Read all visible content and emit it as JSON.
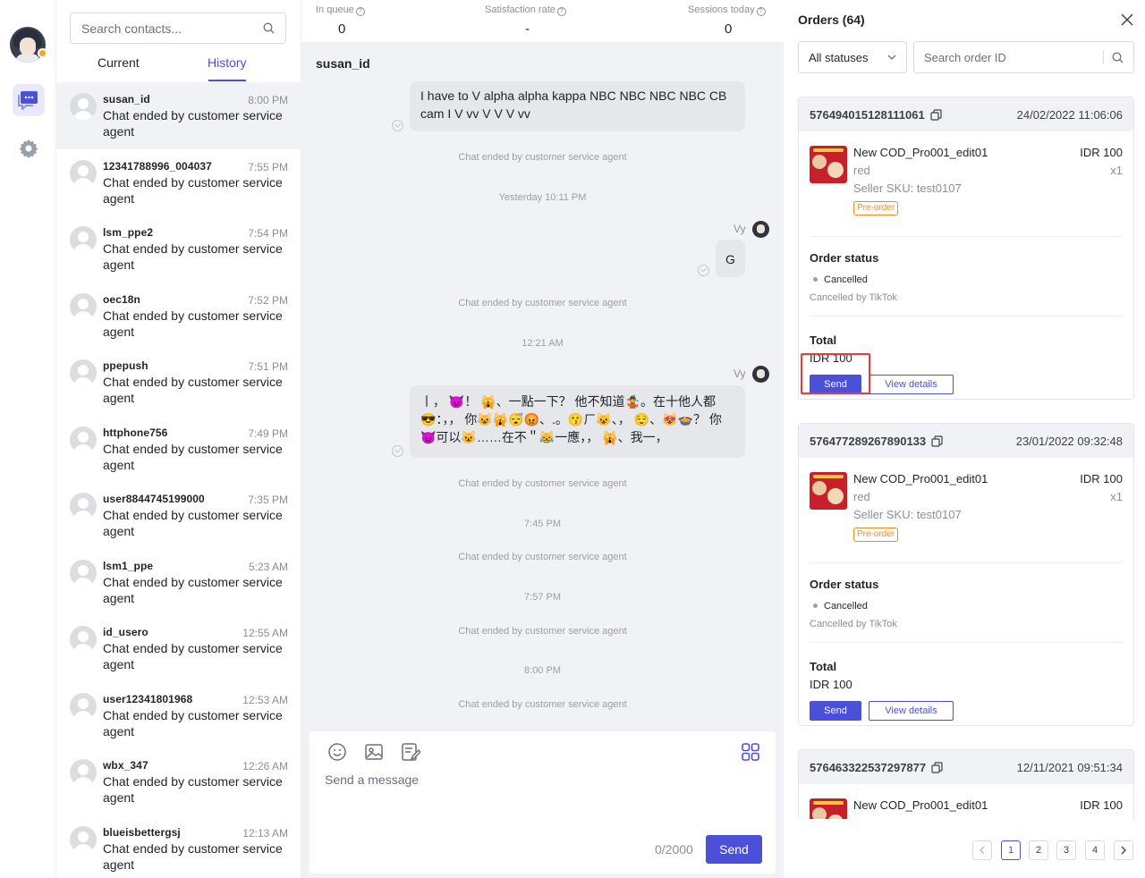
{
  "rail": {
    "items": [
      {
        "name": "chat-icon",
        "active": true
      },
      {
        "name": "gear-icon",
        "active": false
      }
    ]
  },
  "contacts": {
    "search_placeholder": "Search contacts...",
    "tabs": {
      "current": "Current",
      "history": "History"
    },
    "list": [
      {
        "name": "susan_id",
        "time": "8:00 PM",
        "message": "Chat ended by customer service agent",
        "selected": true
      },
      {
        "name": "12341788996_004037",
        "time": "7:55 PM",
        "message": "Chat ended by customer service agent"
      },
      {
        "name": "lsm_ppe2",
        "time": "7:54 PM",
        "message": "Chat ended by customer service agent"
      },
      {
        "name": "oec18n",
        "time": "7:52 PM",
        "message": "Chat ended by customer service agent"
      },
      {
        "name": "ppepush",
        "time": "7:51 PM",
        "message": "Chat ended by customer service agent"
      },
      {
        "name": "httphone756",
        "time": "7:49 PM",
        "message": "Chat ended by customer service agent"
      },
      {
        "name": "user8844745199000",
        "time": "7:35 PM",
        "message": "Chat ended by customer service agent"
      },
      {
        "name": "lsm1_ppe",
        "time": "5:23 AM",
        "message": "Chat ended by customer service agent"
      },
      {
        "name": "id_usero",
        "time": "12:55 AM",
        "message": "Chat ended by customer service agent"
      },
      {
        "name": "user12341801968",
        "time": "12:53 AM",
        "message": "Chat ended by customer service agent"
      },
      {
        "name": "wbx_347",
        "time": "12:26 AM",
        "message": "Chat ended by customer service agent"
      },
      {
        "name": "blueisbettergsj",
        "time": "12:13 AM",
        "message": "Chat ended by customer service agent"
      }
    ]
  },
  "stats": {
    "queue_label": "In queue",
    "queue_value": "0",
    "satisfaction_label": "Satisfaction rate",
    "satisfaction_value": "-",
    "sessions_label": "Sessions today",
    "sessions_value": "0"
  },
  "chat": {
    "title": "susan_id",
    "bubble1": "I have to V alpha alpha kappa NBC NBC NBC NBC CB cam I V vv V V V vv",
    "sys1": "Chat ended by customer service agent",
    "ts1": "Yesterday 10:11 PM",
    "sender1": "Vy",
    "bubble2": "G",
    "sys2": "Chat ended by customer service agent",
    "ts2": "12:21 AM",
    "sender2": "Vy",
    "bubble3": "丨， 😈！ 🙀、一點一下？ 他不知道🤹。在十他人都😎：，，    你😺🙀😴😡、.。😗ㄏ😺、，  😌、😻🍲？ 你😈可以😺……在不＂😹一應，，  🙀、我一，",
    "sys3": "Chat ended by customer service agent",
    "ts3": "7:45 PM",
    "sys4": "Chat ended by customer service agent",
    "ts4": "7:57 PM",
    "sys5": "Chat ended by customer service agent",
    "ts5": "8:00 PM",
    "sys6": "Chat ended by customer service agent"
  },
  "composer": {
    "placeholder": "Send a message",
    "counter": "0/2000",
    "send_label": "Send"
  },
  "orders": {
    "title": "Orders (64)",
    "status_filter": "All statuses",
    "search_placeholder": "Search order ID",
    "cards": [
      {
        "id": "576494015128111061",
        "date": "24/02/2022 11:06:06",
        "product": "New COD_Pro001_edit01",
        "price": "IDR 100",
        "variant": "red",
        "qty": "x1",
        "sku": "Seller SKU: test0107",
        "badge": "Pre-order",
        "status_title": "Order status",
        "status": "Cancelled",
        "status_sub": "Cancelled by TikTok",
        "total_label": "Total",
        "total": "IDR 100",
        "send": "Send",
        "view": "View details"
      },
      {
        "id": "576477289267890133",
        "date": "23/01/2022 09:32:48",
        "product": "New COD_Pro001_edit01",
        "price": "IDR 100",
        "variant": "red",
        "qty": "x1",
        "sku": "Seller SKU: test0107",
        "badge": "Pre-order",
        "status_title": "Order status",
        "status": "Cancelled",
        "status_sub": "Cancelled by TikTok",
        "total_label": "Total",
        "total": "IDR 100",
        "send": "Send",
        "view": "View details"
      },
      {
        "id": "576463322537297877",
        "date": "12/11/2021 09:51:34",
        "product": "New COD_Pro001_edit01",
        "price": "IDR 100"
      }
    ],
    "pagination": {
      "pages": [
        "1",
        "2",
        "3",
        "4"
      ],
      "current": "1"
    }
  },
  "colors": {
    "accent": "#4a50d8",
    "highlight": "#e43c3c",
    "preorder": "#f08b1c"
  }
}
